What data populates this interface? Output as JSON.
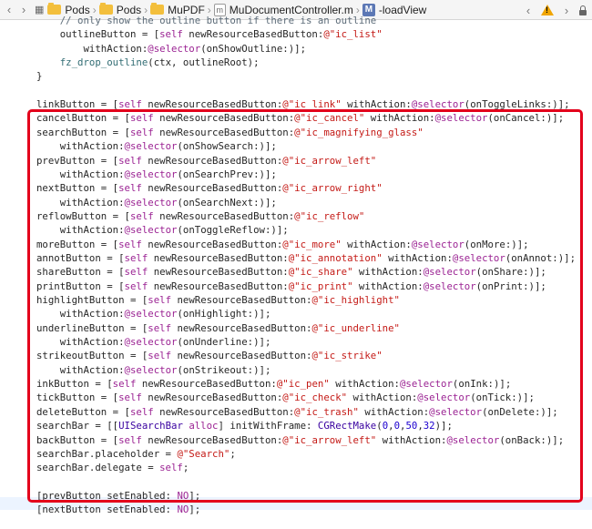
{
  "jumpbar": {
    "back_glyph": "‹",
    "forward_glyph": "›",
    "breadcrumbs": [
      "Pods",
      "Pods",
      "MuPDF",
      "MuDocumentController.m",
      "-loadView"
    ],
    "method_badge": "M",
    "file_glyph": "m",
    "warning_glyph": "!"
  },
  "code": {
    "lines": [
      "    // only show the outline button if there is an outline",
      "    outlineButton = [self newResourceBasedButton:@\"ic_list\"",
      "        withAction:@selector(onShowOutline:)];",
      "    fz_drop_outline(ctx, outlineRoot);",
      "}",
      "",
      "linkButton = [self newResourceBasedButton:@\"ic_link\" withAction:@selector(onToggleLinks:)];",
      "cancelButton = [self newResourceBasedButton:@\"ic_cancel\" withAction:@selector(onCancel:)];",
      "searchButton = [self newResourceBasedButton:@\"ic_magnifying_glass\"",
      "    withAction:@selector(onShowSearch:)];",
      "prevButton = [self newResourceBasedButton:@\"ic_arrow_left\"",
      "    withAction:@selector(onSearchPrev:)];",
      "nextButton = [self newResourceBasedButton:@\"ic_arrow_right\"",
      "    withAction:@selector(onSearchNext:)];",
      "reflowButton = [self newResourceBasedButton:@\"ic_reflow\"",
      "    withAction:@selector(onToggleReflow:)];",
      "moreButton = [self newResourceBasedButton:@\"ic_more\" withAction:@selector(onMore:)];",
      "annotButton = [self newResourceBasedButton:@\"ic_annotation\" withAction:@selector(onAnnot:)];",
      "shareButton = [self newResourceBasedButton:@\"ic_share\" withAction:@selector(onShare:)];",
      "printButton = [self newResourceBasedButton:@\"ic_print\" withAction:@selector(onPrint:)];",
      "highlightButton = [self newResourceBasedButton:@\"ic_highlight\"",
      "    withAction:@selector(onHighlight:)];",
      "underlineButton = [self newResourceBasedButton:@\"ic_underline\"",
      "    withAction:@selector(onUnderline:)];",
      "strikeoutButton = [self newResourceBasedButton:@\"ic_strike\"",
      "    withAction:@selector(onStrikeout:)];",
      "inkButton = [self newResourceBasedButton:@\"ic_pen\" withAction:@selector(onInk:)];",
      "tickButton = [self newResourceBasedButton:@\"ic_check\" withAction:@selector(onTick:)];",
      "deleteButton = [self newResourceBasedButton:@\"ic_trash\" withAction:@selector(onDelete:)];",
      "searchBar = [[UISearchBar alloc] initWithFrame: CGRectMake(0,0,50,32)];",
      "backButton = [self newResourceBasedButton:@\"ic_arrow_left\" withAction:@selector(onBack:)];",
      "searchBar.placeholder = @\"Search\";",
      "searchBar.delegate = self;",
      "",
      "[prevButton setEnabled: NO];",
      "[nextButton setEnabled: NO];"
    ]
  },
  "colors": {
    "keyword": "#9b2393",
    "string": "#c41a16",
    "class": "#3900a0",
    "number": "#1c00cf",
    "comment": "#5d6c79",
    "highlight_border": "#e3001b"
  }
}
